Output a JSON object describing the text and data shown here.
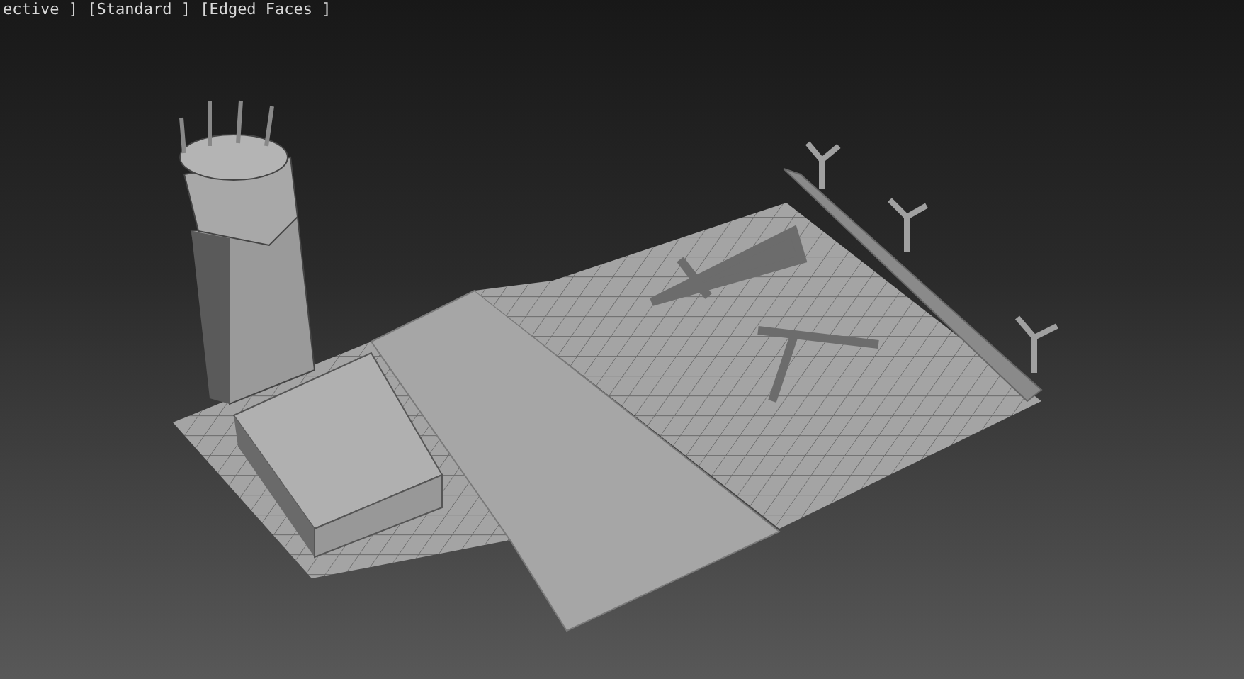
{
  "viewport": {
    "label": "ective ] [Standard ] [Edged Faces ]"
  }
}
